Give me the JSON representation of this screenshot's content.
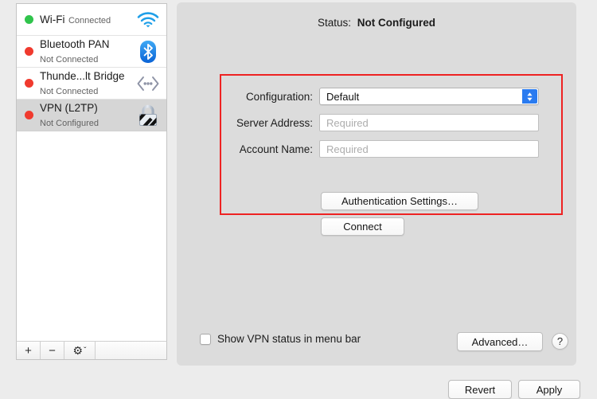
{
  "window": {
    "background_color": "#ececec",
    "panel_color": "#dcdcdc"
  },
  "sidebar": {
    "services": [
      {
        "name": "Wi-Fi",
        "state": "Connected",
        "status_color": "#30c44c",
        "icon": "wifi-icon",
        "selected": false
      },
      {
        "name": "Bluetooth PAN",
        "state": "Not Connected",
        "status_color": "#f03a2e",
        "icon": "bluetooth-icon",
        "selected": false
      },
      {
        "name": "Thunde...lt Bridge",
        "state": "Not Connected",
        "status_color": "#f03a2e",
        "icon": "thunderbolt-bridge-icon",
        "selected": false
      },
      {
        "name": "VPN (L2TP)",
        "state": "Not Configured",
        "status_color": "#f03a2e",
        "icon": "vpn-lock-icon",
        "selected": true
      }
    ],
    "toolbar": {
      "add_label": "+",
      "remove_label": "−",
      "action_label": "⚙",
      "action_chevron": "ˇ"
    }
  },
  "detail": {
    "status_label": "Status:",
    "status_value": "Not Configured",
    "highlight_color": "#ee2222",
    "form": {
      "configuration_label": "Configuration:",
      "configuration_value": "Default",
      "server_address_label": "Server Address:",
      "server_address_value": "",
      "server_address_placeholder": "Required",
      "account_name_label": "Account Name:",
      "account_name_value": "",
      "account_name_placeholder": "Required"
    },
    "auth_settings_label": "Authentication Settings…",
    "connect_label": "Connect",
    "show_vpn_status_label": "Show VPN status in menu bar",
    "show_vpn_status_checked": false,
    "advanced_label": "Advanced…",
    "help_label": "?"
  },
  "footer": {
    "revert_label": "Revert",
    "apply_label": "Apply"
  }
}
